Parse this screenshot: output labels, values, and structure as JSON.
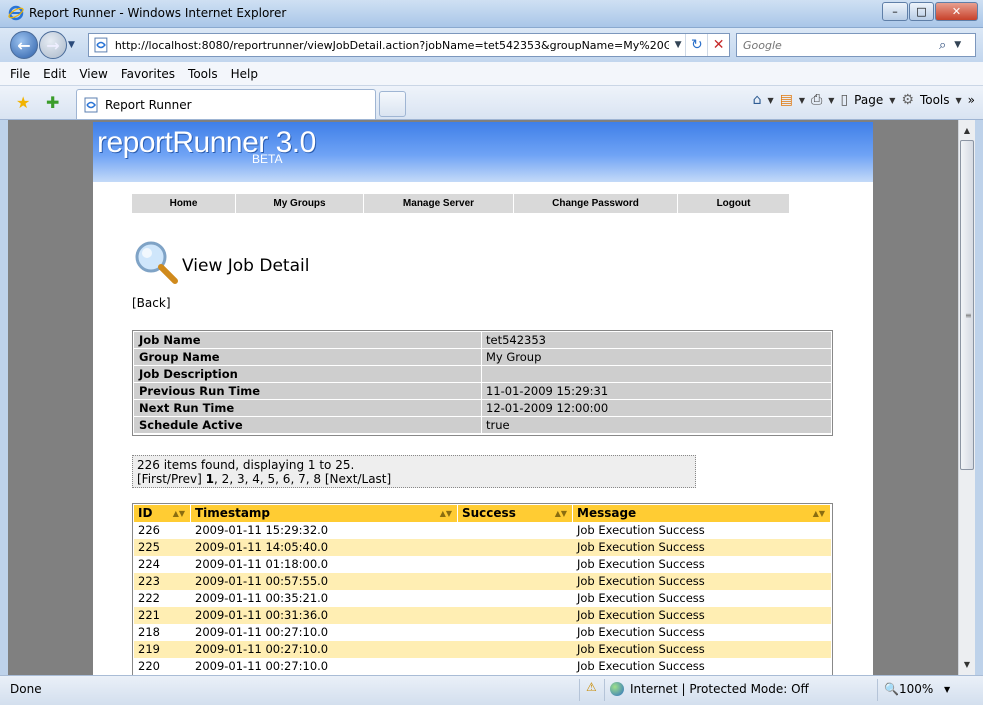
{
  "window": {
    "title": "Report Runner - Windows Internet Explorer",
    "minimize": "–",
    "maximize": "□",
    "close": "✕"
  },
  "address": {
    "back_icon": "←",
    "forward_icon": "→",
    "dropdown": "▼",
    "url": "http://localhost:8080/reportrunner/viewJobDetail.action?jobName=tet542353&groupName=My%20Grc",
    "refresh_icon": "↻",
    "stop_icon": "✕",
    "search_placeholder": "Google",
    "search_icon": "⌕"
  },
  "menu": [
    "File",
    "Edit",
    "View",
    "Favorites",
    "Tools",
    "Help"
  ],
  "tabs": {
    "active_tab": "Report Runner",
    "commands": {
      "page": "Page",
      "tools": "Tools",
      "chevron": "»"
    }
  },
  "page": {
    "brand": "reportRunner 3.0",
    "beta": "BETA",
    "nav": [
      {
        "label": "Home"
      },
      {
        "label": "My Groups"
      },
      {
        "label": "Manage Server"
      },
      {
        "label": "Change Password"
      },
      {
        "label": "Logout"
      }
    ],
    "heading": "View Job Detail",
    "back_link": "[Back]",
    "details": [
      {
        "key": "Job Name",
        "value": "tet542353"
      },
      {
        "key": "Group Name",
        "value": "My Group"
      },
      {
        "key": "Job Description",
        "value": ""
      },
      {
        "key": "Previous Run Time",
        "value": "11-01-2009 15:29:31"
      },
      {
        "key": "Next Run Time",
        "value": "12-01-2009 12:00:00"
      },
      {
        "key": "Schedule Active",
        "value": "true"
      }
    ],
    "pager": {
      "summary": "226 items found, displaying 1 to 25.",
      "first_prev": "[First/Prev]",
      "pages": [
        "1",
        "2",
        "3",
        "4",
        "5",
        "6",
        "7",
        "8"
      ],
      "next_last": "[Next/Last]"
    },
    "results": {
      "columns": [
        "ID",
        "Timestamp",
        "Success",
        "Message"
      ],
      "rows": [
        [
          "226",
          "2009-01-11 15:29:32.0",
          "",
          "Job Execution Success"
        ],
        [
          "225",
          "2009-01-11 14:05:40.0",
          "",
          "Job Execution Success"
        ],
        [
          "224",
          "2009-01-11 01:18:00.0",
          "",
          "Job Execution Success"
        ],
        [
          "223",
          "2009-01-11 00:57:55.0",
          "",
          "Job Execution Success"
        ],
        [
          "222",
          "2009-01-11 00:35:21.0",
          "",
          "Job Execution Success"
        ],
        [
          "221",
          "2009-01-11 00:31:36.0",
          "",
          "Job Execution Success"
        ],
        [
          "218",
          "2009-01-11 00:27:10.0",
          "",
          "Job Execution Success"
        ],
        [
          "219",
          "2009-01-11 00:27:10.0",
          "",
          "Job Execution Success"
        ],
        [
          "220",
          "2009-01-11 00:27:10.0",
          "",
          "Job Execution Success"
        ]
      ]
    }
  },
  "status": {
    "text": "Done",
    "zone": "Internet | Protected Mode: Off",
    "zoom": "100%"
  },
  "colors": {
    "header_yellow": "#ffcc33",
    "row_alt": "#ffeeb3",
    "detail_gray": "#cecece",
    "banner_blue": "#3f7fe8"
  }
}
